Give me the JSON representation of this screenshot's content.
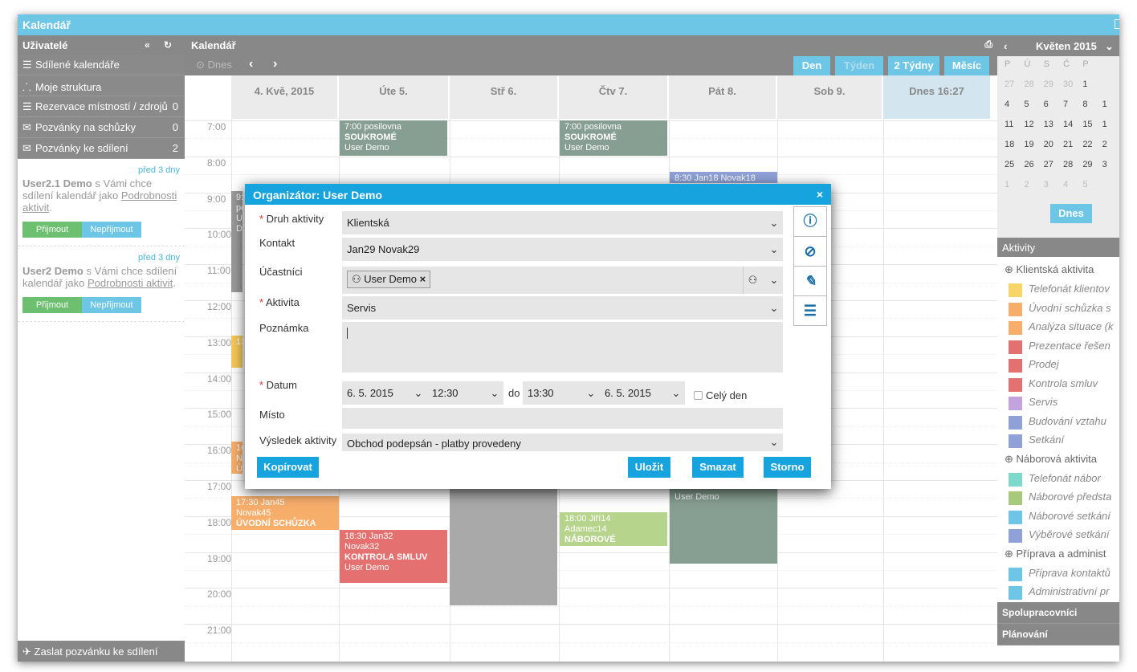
{
  "window": {
    "title": "Kalendář"
  },
  "left": {
    "title": "Uživatelé",
    "collapse_icon": "«",
    "refresh_icon": "↻",
    "items": [
      {
        "icon": "☰",
        "label": "Sdílené kalendáře",
        "count": ""
      },
      {
        "icon": "⸫",
        "label": "Moje struktura",
        "count": ""
      },
      {
        "icon": "☰",
        "label": "Rezervace místností / zdrojů",
        "count": "0"
      },
      {
        "icon": "✉",
        "label": "Pozvánky na schůzky",
        "count": "0"
      },
      {
        "icon": "✉",
        "label": "Pozvánky ke sdílení",
        "count": "2"
      }
    ],
    "notifications": [
      {
        "when": "před 3 dny",
        "user": "User2.1 Demo",
        "text": " s Vámi chce sdílení kalendář jako ",
        "link": "Podrobnosti aktivit",
        "end": ".",
        "accept": "Přijmout",
        "reject": "Nepřijmout"
      },
      {
        "when": "před 3 dny",
        "user": "User2 Demo",
        "text": " s Vámi chce sdílení kalendář jako ",
        "link": "Podrobnosti aktivit",
        "end": ".",
        "accept": "Přijmout",
        "reject": "Nepřijmout"
      }
    ],
    "footer": "Zaslat pozvánku ke sdílení"
  },
  "center": {
    "title": "Kalendář",
    "today_link": "Dnes",
    "views": [
      "Den",
      "Týden",
      "2 Týdny",
      "Měsíc"
    ],
    "days": [
      "4. Kvě, 2015",
      "Úte 5.",
      "Stř 6.",
      "Čtv 7.",
      "Pát 8.",
      "Sob 9.",
      "Dnes 16:27"
    ],
    "hours": [
      "7:00",
      "8:00",
      "9:00",
      "10:00",
      "11:00",
      "12:00",
      "13:00",
      "14:00",
      "15:00",
      "16:00",
      "17:00",
      "18:00",
      "19:00",
      "20:00",
      "21:00"
    ],
    "events": [
      {
        "line1": "7:00 posilovna",
        "line2": "SOUKROMÉ",
        "line3": "User Demo",
        "color": "#879e92"
      },
      {
        "line1": "7:00 posilovna",
        "line2": "SOUKROMÉ",
        "line3": "User Demo",
        "color": "#879e92"
      },
      {
        "line1": "8:30 Jan18 Novak18",
        "line2": "",
        "line3": "",
        "color": "#8fa1d6"
      },
      {
        "line1": "9:",
        "line2": "po",
        "line3": "Us",
        "line4": "De",
        "color": "#999999"
      },
      {
        "line1": "13",
        "line2": "",
        "line3": "",
        "color": "#f5c85a"
      },
      {
        "line1": "16",
        "line2": "No",
        "line3": "ÚV",
        "color": "#f7ae6b"
      },
      {
        "line1": "17:30 Jan45",
        "line2": "Novak45",
        "line3": "ÚVODNÍ SCHŮZKA",
        "color": "#f7ae6b"
      },
      {
        "line1": "18:30 Jan32",
        "line2": "Novak32",
        "line3": "KONTROLA SMLUV",
        "line4": "User Demo",
        "color": "#e4706f"
      },
      {
        "line1": "18:00 Jiří14",
        "line2": "Adamec14",
        "line3": "NÁBOROVÉ",
        "color": "#b7d48c"
      },
      {
        "line1": "SOUKROMÉ",
        "line2": "User Demo",
        "color": "#879e92"
      }
    ]
  },
  "right": {
    "month": "Květen 2015",
    "weekday_headers": [
      "P",
      "Ú",
      "S",
      "Č",
      "P"
    ],
    "weeks": [
      [
        "27",
        "28",
        "29",
        "30",
        "1"
      ],
      [
        "4",
        "5",
        "6",
        "7",
        "8"
      ],
      [
        "11",
        "12",
        "13",
        "14",
        "15"
      ],
      [
        "18",
        "19",
        "20",
        "21",
        "22"
      ],
      [
        "25",
        "26",
        "27",
        "28",
        "29"
      ],
      [
        "1",
        "2",
        "3",
        "4",
        "5"
      ]
    ],
    "week_extra": [
      "",
      "1",
      "1",
      "2",
      "3",
      ""
    ],
    "today_button": "Dnes",
    "activities_title": "Aktivity",
    "groups": [
      {
        "name": "Klientská aktivita",
        "items": [
          {
            "label": "Telefonát klientov",
            "color": "#f7d56b"
          },
          {
            "label": "Úvodní schůzka s",
            "color": "#f7ae6b"
          },
          {
            "label": "Analýza situace (k",
            "color": "#f7ae6b"
          },
          {
            "label": "Prezentace řešen",
            "color": "#e4706f"
          },
          {
            "label": "Prodej",
            "color": "#e4706f"
          },
          {
            "label": "Kontrola smluv",
            "color": "#e4706f"
          },
          {
            "label": "Servis",
            "color": "#c3a2e0"
          },
          {
            "label": "Budování vztahu",
            "color": "#8fa1d6"
          },
          {
            "label": "Setkání",
            "color": "#8fa1d6"
          }
        ]
      },
      {
        "name": "Náborová aktivita",
        "items": [
          {
            "label": "Telefonát nábor",
            "color": "#7dd9c9"
          },
          {
            "label": "Náborové předsta",
            "color": "#a8c97a"
          },
          {
            "label": "Náborové setkání",
            "color": "#6ec6e6"
          },
          {
            "label": "Výběrové setkání",
            "color": "#8fa1d6"
          }
        ]
      },
      {
        "name": "Příprava a administ",
        "items": [
          {
            "label": "Příprava kontaktů",
            "color": "#6ec6e6"
          },
          {
            "label": "Administrativní pr",
            "color": "#6ec6e6"
          }
        ]
      }
    ],
    "footer1": "Spolupracovníci",
    "footer2": "Plánování"
  },
  "modal": {
    "title": "Organizátor: User Demo",
    "close": "×",
    "labels": {
      "druh": "Druh aktivity",
      "kontakt": "Kontakt",
      "ucastnici": "Účastníci",
      "aktivita": "Aktivita",
      "poznamka": "Poznámka",
      "datum": "Datum",
      "misto": "Místo",
      "vysledek": "Výsledek aktivity"
    },
    "values": {
      "druh": "Klientská",
      "kontakt": "Jan29 Novak29",
      "ucastnik": "User Demo",
      "aktivita": "Servis",
      "poznamka": "",
      "datum_od": "6. 5. 2015",
      "cas_od": "12:30",
      "do": "do",
      "cas_do": "13:30",
      "datum_do": "6. 5. 2015",
      "cely_den": "Celý den",
      "misto": "",
      "vysledek": "Obchod podepsán - platby provedeny"
    },
    "side_icons": [
      "info-icon",
      "clock-check-icon",
      "pencil-icon",
      "list-icon"
    ],
    "buttons": {
      "copy": "Kopírovat",
      "save": "Uložit",
      "delete": "Smazat",
      "cancel": "Storno"
    }
  }
}
